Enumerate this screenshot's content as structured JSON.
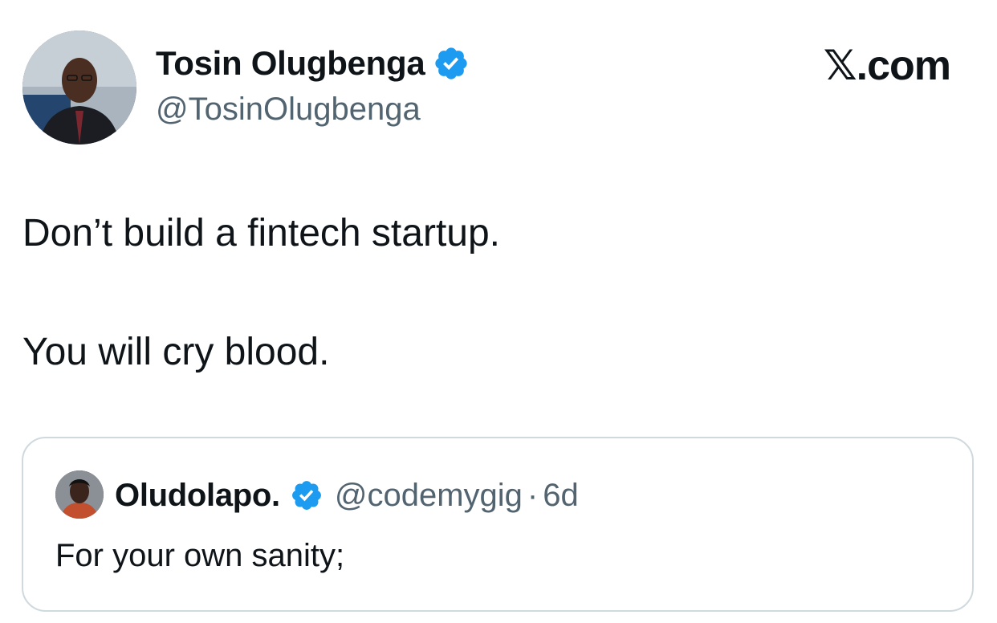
{
  "author": {
    "name": "Tosin Olugbenga",
    "handle": "@TosinOlugbenga",
    "verified": true,
    "avatar_icon": "profile-photo"
  },
  "brand": {
    "label": "𝕏.com"
  },
  "tweet": {
    "line1": "Don’t build a fintech startup.",
    "line2": "You will cry blood."
  },
  "quote": {
    "name": "Oludolapo.",
    "handle": "@codemygig",
    "separator": "·",
    "time": "6d",
    "verified": true,
    "text": "For your own sanity;",
    "avatar_icon": "profile-photo"
  },
  "colors": {
    "text": "#0f1419",
    "muted": "#536471",
    "verified_blue": "#1d9bf0",
    "border": "#cfd9de"
  }
}
